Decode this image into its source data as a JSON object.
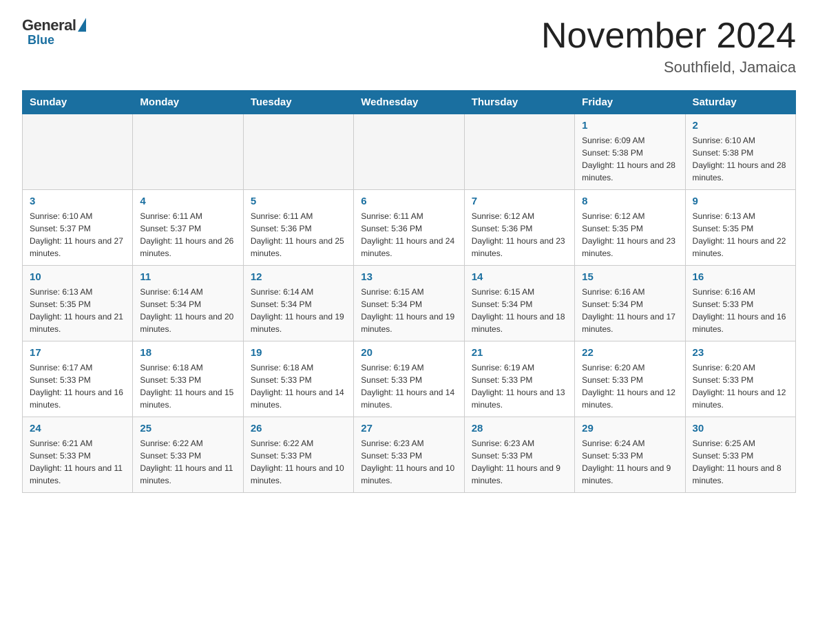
{
  "logo": {
    "general": "General",
    "blue": "Blue"
  },
  "header": {
    "month": "November 2024",
    "location": "Southfield, Jamaica"
  },
  "days_of_week": [
    "Sunday",
    "Monday",
    "Tuesday",
    "Wednesday",
    "Thursday",
    "Friday",
    "Saturday"
  ],
  "weeks": [
    [
      {
        "day": "",
        "info": ""
      },
      {
        "day": "",
        "info": ""
      },
      {
        "day": "",
        "info": ""
      },
      {
        "day": "",
        "info": ""
      },
      {
        "day": "",
        "info": ""
      },
      {
        "day": "1",
        "info": "Sunrise: 6:09 AM\nSunset: 5:38 PM\nDaylight: 11 hours and 28 minutes."
      },
      {
        "day": "2",
        "info": "Sunrise: 6:10 AM\nSunset: 5:38 PM\nDaylight: 11 hours and 28 minutes."
      }
    ],
    [
      {
        "day": "3",
        "info": "Sunrise: 6:10 AM\nSunset: 5:37 PM\nDaylight: 11 hours and 27 minutes."
      },
      {
        "day": "4",
        "info": "Sunrise: 6:11 AM\nSunset: 5:37 PM\nDaylight: 11 hours and 26 minutes."
      },
      {
        "day": "5",
        "info": "Sunrise: 6:11 AM\nSunset: 5:36 PM\nDaylight: 11 hours and 25 minutes."
      },
      {
        "day": "6",
        "info": "Sunrise: 6:11 AM\nSunset: 5:36 PM\nDaylight: 11 hours and 24 minutes."
      },
      {
        "day": "7",
        "info": "Sunrise: 6:12 AM\nSunset: 5:36 PM\nDaylight: 11 hours and 23 minutes."
      },
      {
        "day": "8",
        "info": "Sunrise: 6:12 AM\nSunset: 5:35 PM\nDaylight: 11 hours and 23 minutes."
      },
      {
        "day": "9",
        "info": "Sunrise: 6:13 AM\nSunset: 5:35 PM\nDaylight: 11 hours and 22 minutes."
      }
    ],
    [
      {
        "day": "10",
        "info": "Sunrise: 6:13 AM\nSunset: 5:35 PM\nDaylight: 11 hours and 21 minutes."
      },
      {
        "day": "11",
        "info": "Sunrise: 6:14 AM\nSunset: 5:34 PM\nDaylight: 11 hours and 20 minutes."
      },
      {
        "day": "12",
        "info": "Sunrise: 6:14 AM\nSunset: 5:34 PM\nDaylight: 11 hours and 19 minutes."
      },
      {
        "day": "13",
        "info": "Sunrise: 6:15 AM\nSunset: 5:34 PM\nDaylight: 11 hours and 19 minutes."
      },
      {
        "day": "14",
        "info": "Sunrise: 6:15 AM\nSunset: 5:34 PM\nDaylight: 11 hours and 18 minutes."
      },
      {
        "day": "15",
        "info": "Sunrise: 6:16 AM\nSunset: 5:34 PM\nDaylight: 11 hours and 17 minutes."
      },
      {
        "day": "16",
        "info": "Sunrise: 6:16 AM\nSunset: 5:33 PM\nDaylight: 11 hours and 16 minutes."
      }
    ],
    [
      {
        "day": "17",
        "info": "Sunrise: 6:17 AM\nSunset: 5:33 PM\nDaylight: 11 hours and 16 minutes."
      },
      {
        "day": "18",
        "info": "Sunrise: 6:18 AM\nSunset: 5:33 PM\nDaylight: 11 hours and 15 minutes."
      },
      {
        "day": "19",
        "info": "Sunrise: 6:18 AM\nSunset: 5:33 PM\nDaylight: 11 hours and 14 minutes."
      },
      {
        "day": "20",
        "info": "Sunrise: 6:19 AM\nSunset: 5:33 PM\nDaylight: 11 hours and 14 minutes."
      },
      {
        "day": "21",
        "info": "Sunrise: 6:19 AM\nSunset: 5:33 PM\nDaylight: 11 hours and 13 minutes."
      },
      {
        "day": "22",
        "info": "Sunrise: 6:20 AM\nSunset: 5:33 PM\nDaylight: 11 hours and 12 minutes."
      },
      {
        "day": "23",
        "info": "Sunrise: 6:20 AM\nSunset: 5:33 PM\nDaylight: 11 hours and 12 minutes."
      }
    ],
    [
      {
        "day": "24",
        "info": "Sunrise: 6:21 AM\nSunset: 5:33 PM\nDaylight: 11 hours and 11 minutes."
      },
      {
        "day": "25",
        "info": "Sunrise: 6:22 AM\nSunset: 5:33 PM\nDaylight: 11 hours and 11 minutes."
      },
      {
        "day": "26",
        "info": "Sunrise: 6:22 AM\nSunset: 5:33 PM\nDaylight: 11 hours and 10 minutes."
      },
      {
        "day": "27",
        "info": "Sunrise: 6:23 AM\nSunset: 5:33 PM\nDaylight: 11 hours and 10 minutes."
      },
      {
        "day": "28",
        "info": "Sunrise: 6:23 AM\nSunset: 5:33 PM\nDaylight: 11 hours and 9 minutes."
      },
      {
        "day": "29",
        "info": "Sunrise: 6:24 AM\nSunset: 5:33 PM\nDaylight: 11 hours and 9 minutes."
      },
      {
        "day": "30",
        "info": "Sunrise: 6:25 AM\nSunset: 5:33 PM\nDaylight: 11 hours and 8 minutes."
      }
    ]
  ]
}
